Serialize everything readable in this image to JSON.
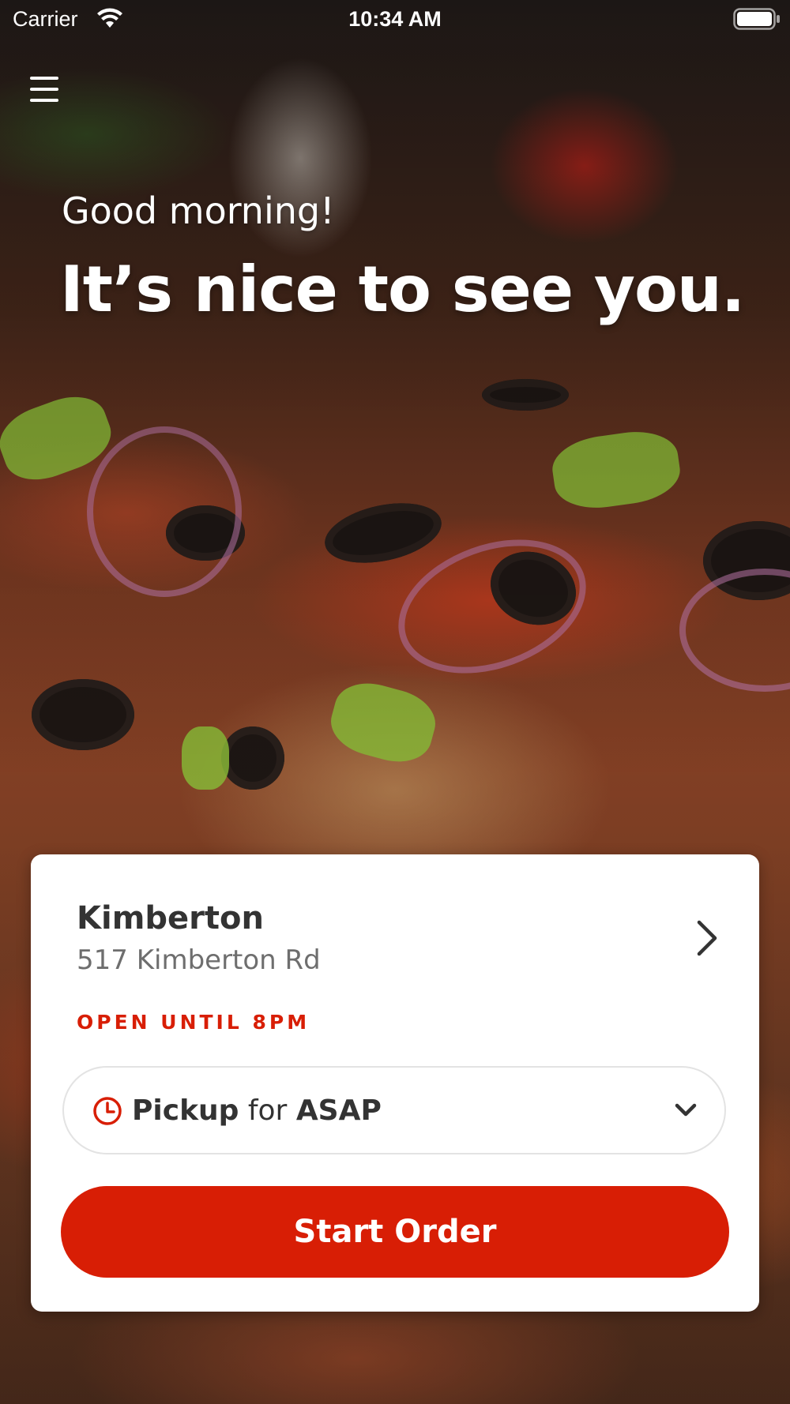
{
  "status_bar": {
    "carrier": "Carrier",
    "time": "10:34 AM"
  },
  "icons": {
    "menu": "hamburger-menu-icon",
    "wifi": "wifi-icon",
    "battery": "battery-icon",
    "store_chevron": "chevron-right-icon",
    "clock": "clock-icon",
    "dropdown": "chevron-down-icon"
  },
  "hero": {
    "greeting": "Good morning!",
    "headline": "It’s nice to see you."
  },
  "store": {
    "name": "Kimberton",
    "address": "517 Kimberton Rd",
    "hours": "OPEN UNTIL 8PM"
  },
  "order": {
    "mode": "Pickup",
    "connector": "for",
    "time": "ASAP",
    "start_label": "Start Order"
  },
  "colors": {
    "accent": "#d81e05",
    "card_background": "#ffffff",
    "text_primary": "#333333",
    "text_secondary": "#6e6e6e"
  }
}
